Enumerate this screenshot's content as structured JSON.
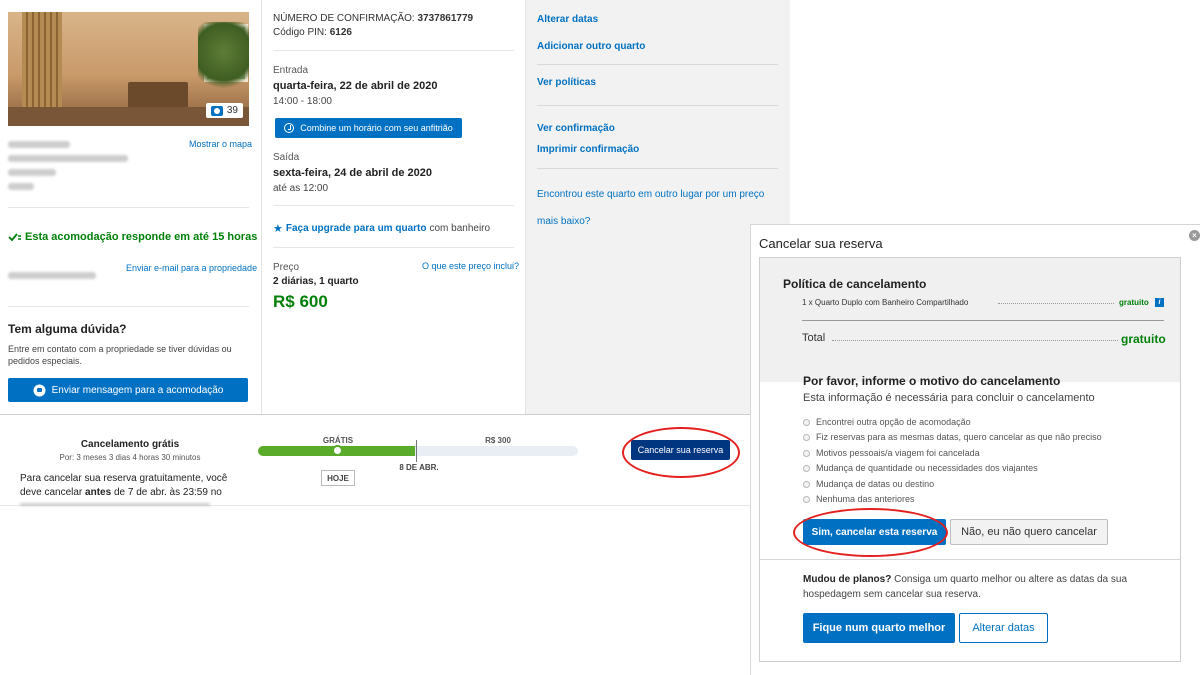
{
  "property": {
    "photo_count": "39",
    "map_link": "Mostrar o mapa",
    "response_notice": "Esta acomodação responde em até 15 horas",
    "email_link": "Enviar e-mail para a propriedade",
    "question_title": "Tem alguma dúvida?",
    "question_text": "Entre em contato com a propriedade se tiver dúvidas ou pedidos especiais.",
    "message_button": "Enviar mensagem para a acomodação"
  },
  "booking": {
    "confirmation_label": "NÚMERO DE CONFIRMAÇÃO:",
    "confirmation_number": "3737861779",
    "pin_label": "Código PIN:",
    "pin": "6126",
    "checkin_label": "Entrada",
    "checkin_date": "quarta-feira, 22 de abril de 2020",
    "checkin_time": "14:00 - 18:00",
    "arrange_button": "Combine um horário com seu anfitrião",
    "checkout_label": "Saída",
    "checkout_date": "sexta-feira, 24 de abril de 2020",
    "checkout_time": "até as 12:00",
    "upgrade_link": "Faça upgrade para um quarto",
    "upgrade_suffix": "com banheiro",
    "price_label": "Preço",
    "price_info_link": "O que este preço inclui?",
    "price_detail": "2 diárias, 1 quarto",
    "price_total": "R$ 600"
  },
  "actions": {
    "change_dates": "Alterar datas",
    "add_room": "Adicionar outro quarto",
    "view_policies": "Ver políticas",
    "view_confirmation": "Ver confirmação",
    "print_confirmation": "Imprimir confirmação",
    "cheaper_line1": "Encontrou este quarto em outro lugar por um preço",
    "cheaper_line2": "mais baixo?"
  },
  "cancellation": {
    "title": "Cancelamento grátis",
    "remaining": "Por: 3 meses 3 dias 4 horas 30 minutos",
    "text_line1": "Para cancelar sua reserva gratuitamente, você",
    "text_line2_pre": "deve cancelar",
    "text_line2_bold": "antes",
    "text_line2_post": "de 7 de abr. às 23:59 no",
    "free_label": "GRÁTIS",
    "fee_label": "R$ 300",
    "date_marker": "8 DE ABR.",
    "today_label": "HOJE",
    "cancel_button": "Cancelar sua reserva",
    "free_progress": 0.49
  },
  "modal": {
    "title": "Cancelar sua reserva",
    "policy_title": "Política de cancelamento",
    "room_line": "1 x Quarto Duplo com Banheiro Compartilhado",
    "room_value": "gratuito",
    "total_label": "Total",
    "total_value": "gratuito",
    "reason_title": "Por favor, informe o motivo do cancelamento",
    "reason_subtitle": "Esta informação é necessária para concluir o cancelamento",
    "reasons": [
      "Encontrei outra opção de acomodação",
      "Fiz reservas para as mesmas datas, quero cancelar as que não preciso",
      "Motivos pessoais/a viagem foi cancelada",
      "Mudança de quantidade ou necessidades dos viajantes",
      "Mudança de datas ou destino",
      "Nenhuma das anteriores"
    ],
    "confirm_button": "Sim, cancelar esta reserva",
    "decline_button": "Não, eu não quero cancelar",
    "change_plans_bold": "Mudou de planos?",
    "change_plans_text": "Consiga um quarto melhor ou altere as datas da sua hospedagem sem cancelar sua reserva.",
    "better_room_button": "Fique num quarto melhor",
    "change_dates_button": "Alterar datas"
  },
  "colors": {
    "accent": "#0071c2",
    "green": "#008009",
    "highlight": "#e4201e",
    "navy_button": "#003580"
  },
  "icons": [
    "camera-icon",
    "clock-icon",
    "star-icon",
    "chat-icon",
    "info-icon",
    "close-icon",
    "response-icon"
  ]
}
